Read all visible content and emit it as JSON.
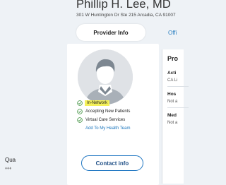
{
  "provider": {
    "name": "Phillip H. Lee, MD",
    "address": "301 W Huntington Dr Ste 215 Arcadia, CA 91007"
  },
  "tabs": [
    {
      "label": "Provider Info",
      "active": true
    },
    {
      "label": "Offi",
      "active": false
    }
  ],
  "status": [
    {
      "label": "In-Network",
      "highlighted": true,
      "icon": "check-circle-icon"
    },
    {
      "label": "Accepting New Patients",
      "highlighted": false,
      "icon": "check-circle-icon"
    },
    {
      "label": "Virtual Care Services",
      "highlighted": false,
      "icon": "check-circle-icon"
    }
  ],
  "add_link": "Add To My Health Team",
  "contact_button": "Contact info",
  "side_panel": {
    "title": "Pro",
    "fields": [
      {
        "label": "Acti",
        "value": "CA Li"
      },
      {
        "label": "Hos",
        "value": "Not a"
      },
      {
        "label": "Med",
        "value": "Not a"
      }
    ],
    "qualifications": "Qua",
    "qual_icon": "♦♦♦"
  },
  "colors": {
    "accent": "#1f76c2",
    "highlight": "#f4f05a",
    "check_green": "#3a8f3a",
    "background": "#eef2f6"
  }
}
